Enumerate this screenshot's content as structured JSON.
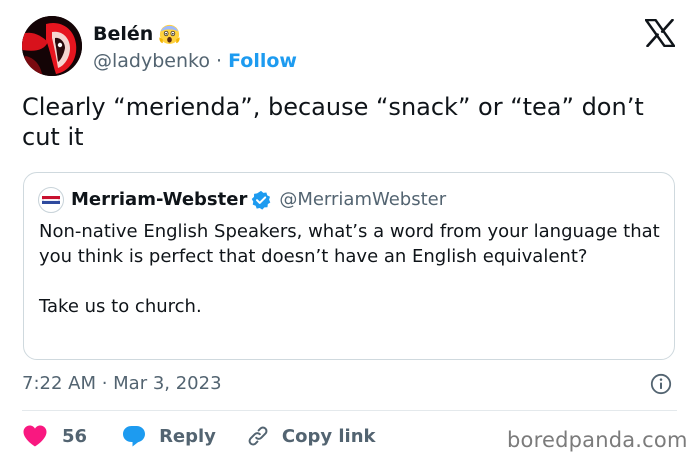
{
  "author": {
    "name": "Belén",
    "name_emoji_icon": "screaming-face-emoji-icon",
    "handle": "@ladybenko",
    "separator": " · ",
    "follow_label": "Follow"
  },
  "platform_logo": "x-logo-icon",
  "tweet": {
    "text": "Clearly “merienda”, because “snack” or “tea” don’t cut it"
  },
  "quoted_tweet": {
    "name": "Merriam-Webster",
    "verified_icon": "verified-badge-icon",
    "handle": "@MerriamWebster",
    "paragraph_1": "Non-native English Speakers, what’s a word from your language that you think is perfect that doesn’t have an English equivalent?",
    "paragraph_2": "Take us to church."
  },
  "meta": {
    "timestamp": "7:22 AM · Mar 3, 2023",
    "info_icon": "info-icon"
  },
  "actions": {
    "like_count": "56",
    "reply_label": "Reply",
    "copy_link_label": "Copy link"
  },
  "watermark": "boredpanda.com",
  "colors": {
    "accent_blue": "#1d9bf0",
    "like_pink": "#f91880",
    "secondary_text": "#536471",
    "border": "#cfd9de"
  }
}
